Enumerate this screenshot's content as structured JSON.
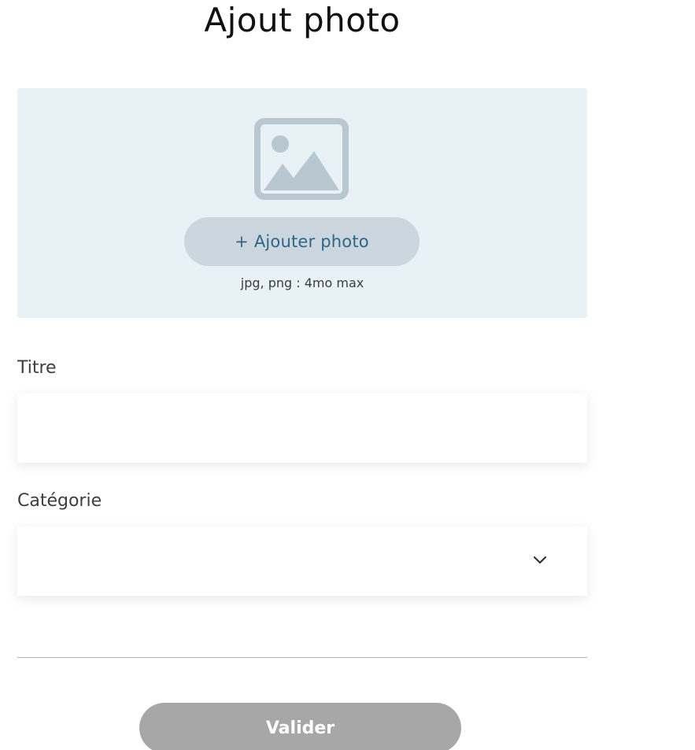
{
  "page": {
    "title": "Ajout photo"
  },
  "upload": {
    "icon": "image-placeholder-icon",
    "button_label": "+ Ajouter photo",
    "hint": "jpg, png : 4mo max",
    "colors": {
      "zone_background": "#e8f1f6",
      "button_background": "#cbd6de",
      "button_text": "#306685",
      "icon": "#b9c7d0"
    }
  },
  "form": {
    "title_field": {
      "label": "Titre",
      "value": "",
      "placeholder": ""
    },
    "category_field": {
      "label": "Catégorie",
      "selected": "",
      "icon": "chevron-down-icon"
    }
  },
  "actions": {
    "validate_label": "Valider",
    "validate_color": "#a7a7a7"
  }
}
